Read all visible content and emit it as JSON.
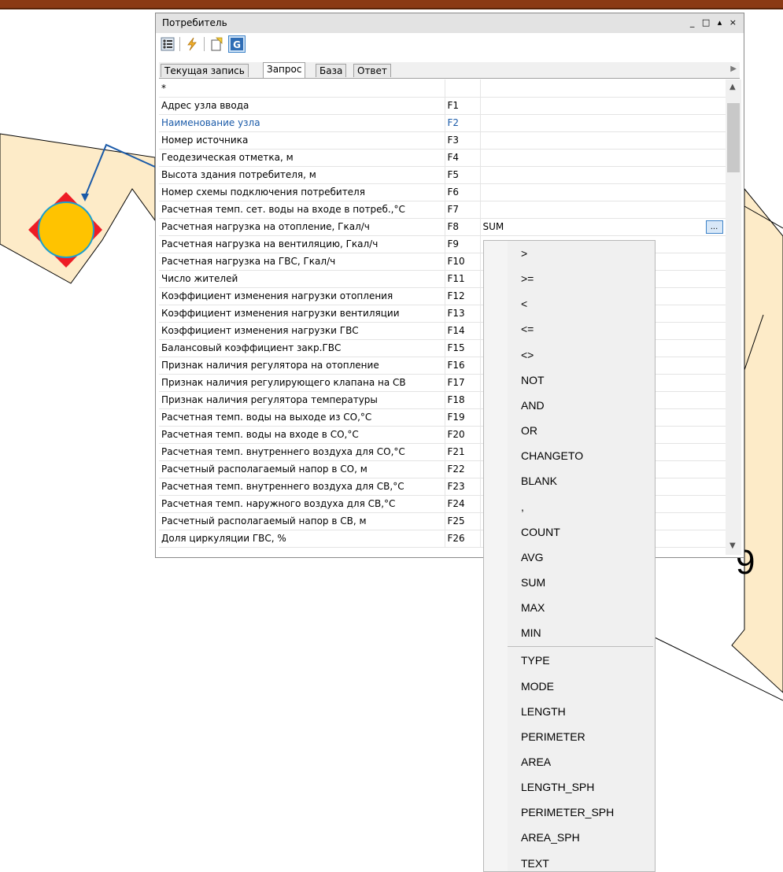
{
  "window": {
    "title": "Потребитель",
    "controls": [
      "_",
      "□",
      "▴",
      "×"
    ]
  },
  "toolbar": {
    "buttons": [
      {
        "icon": "options-icon"
      },
      {
        "icon": "lightning-icon"
      },
      {
        "icon": "new-document-icon"
      },
      {
        "icon": "g-icon",
        "text": "G",
        "active": true
      }
    ]
  },
  "tabs": [
    {
      "label": "Текущая запись",
      "active": false
    },
    {
      "label": "Запрос",
      "active": true
    },
    {
      "label": "База",
      "active": false
    },
    {
      "label": "Ответ",
      "active": false
    }
  ],
  "grid": {
    "header_row": [
      "*",
      "",
      ""
    ],
    "rows": [
      {
        "name": "Адрес узла ввода",
        "code": "F1",
        "value": ""
      },
      {
        "name": "Наименование узла",
        "code": "F2",
        "value": "",
        "highlight": true
      },
      {
        "name": "Номер источника",
        "code": "F3",
        "value": ""
      },
      {
        "name": "Геодезическая отметка, м",
        "code": "F4",
        "value": ""
      },
      {
        "name": "Высота здания потребителя, м",
        "code": "F5",
        "value": ""
      },
      {
        "name": "Номер схемы подключения потребителя",
        "code": "F6",
        "value": ""
      },
      {
        "name": "Расчетная темп. сет. воды на входе в потреб.,°С",
        "code": "F7",
        "value": ""
      },
      {
        "name": "Расчетная нагрузка на отопление, Гкал/ч",
        "code": "F8",
        "value": "SUM",
        "editing": true,
        "button": "..."
      },
      {
        "name": "Расчетная нагрузка на вентиляцию, Гкал/ч",
        "code": "F9",
        "value": ""
      },
      {
        "name": "Расчетная нагрузка на ГВС, Гкал/ч",
        "code": "F10",
        "value": ""
      },
      {
        "name": "Число жителей",
        "code": "F11",
        "value": ""
      },
      {
        "name": "Коэффициент изменения нагрузки отопления",
        "code": "F12",
        "value": ""
      },
      {
        "name": "Коэффициент изменения нагрузки вентиляции",
        "code": "F13",
        "value": ""
      },
      {
        "name": "Коэффициент изменения нагрузки ГВС",
        "code": "F14",
        "value": ""
      },
      {
        "name": "Балансовый коэффициент закр.ГВС",
        "code": "F15",
        "value": ""
      },
      {
        "name": "Признак наличия регулятора на отопление",
        "code": "F16",
        "value": ""
      },
      {
        "name": "Признак наличия регулирующего клапана на СВ",
        "code": "F17",
        "value": ""
      },
      {
        "name": "Признак наличия регулятора температуры",
        "code": "F18",
        "value": ""
      },
      {
        "name": "Расчетная темп. воды на выходе из СО,°С",
        "code": "F19",
        "value": ""
      },
      {
        "name": "Расчетная темп. воды на входе в СО,°С",
        "code": "F20",
        "value": ""
      },
      {
        "name": "Расчетная темп. внутреннего воздуха для СО,°С",
        "code": "F21",
        "value": ""
      },
      {
        "name": "Расчетный располагаемый напор в СО, м",
        "code": "F22",
        "value": ""
      },
      {
        "name": "Расчетная темп. внутреннего воздуха для СВ,°С",
        "code": "F23",
        "value": ""
      },
      {
        "name": "Расчетная темп. наружного воздуха для СВ,°С",
        "code": "F24",
        "value": ""
      },
      {
        "name": "Расчетный располагаемый напор в СВ, м",
        "code": "F25",
        "value": ""
      },
      {
        "name": "Доля циркуляции ГВС, %",
        "code": "F26",
        "value": ""
      }
    ]
  },
  "dropdown": {
    "items": [
      ">",
      ">=",
      "<",
      "<=",
      "<>",
      "NOT",
      "AND",
      "OR",
      "CHANGETO",
      "BLANK",
      ",",
      "COUNT",
      "AVG",
      "SUM",
      "MAX",
      "MIN",
      "TYPE",
      "MODE",
      "LENGTH",
      "PERIMETER",
      "AREA",
      "LENGTH_SPH",
      "PERIMETER_SPH",
      "AREA_SPH",
      "TEXT"
    ]
  },
  "map": {
    "label": "9",
    "colors": {
      "parcel": "#fdebc8",
      "node_fill": "#ffc300",
      "node_square": "#ee1c25",
      "pipe": "#1a5aa8"
    }
  },
  "colors": {
    "accent": "#3e83c8",
    "frame": "#8b3a14"
  }
}
